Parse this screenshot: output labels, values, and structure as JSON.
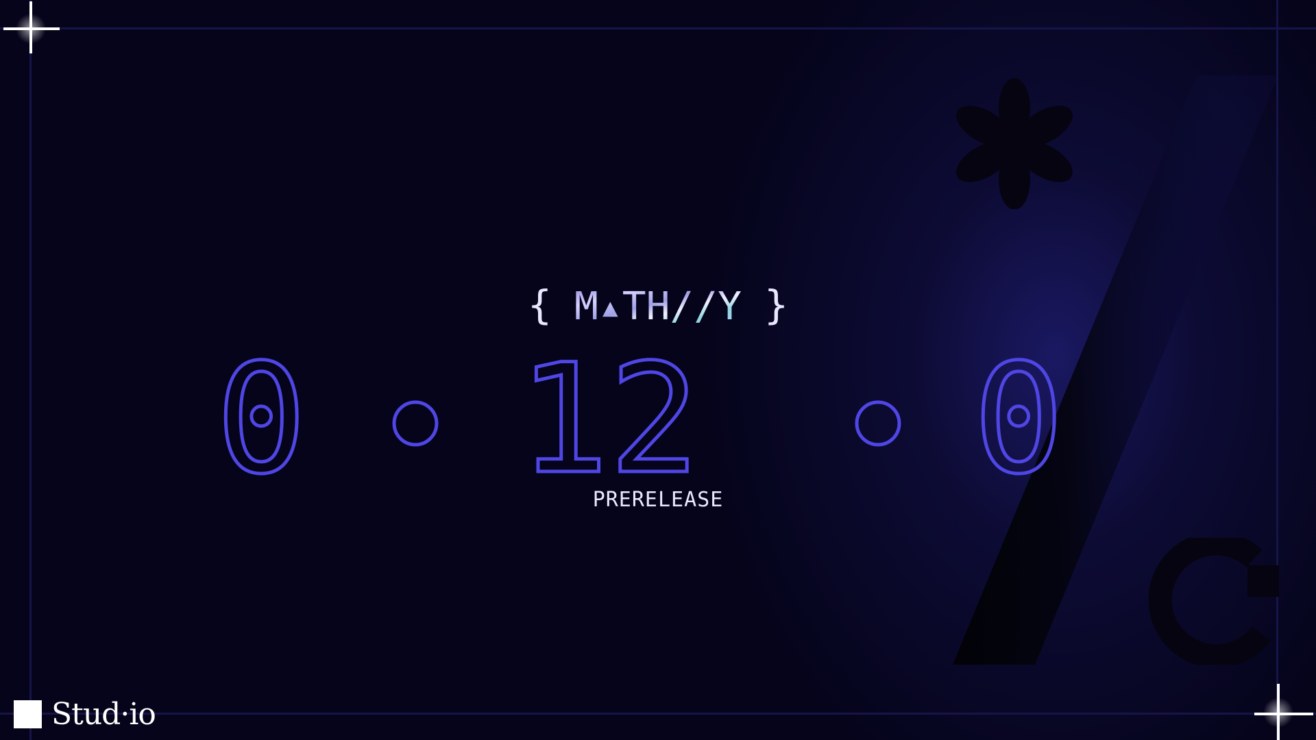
{
  "logo": {
    "brace_left": "{",
    "brace_right": "}",
    "wordmark": "M▴TH//Y"
  },
  "version": {
    "major": "0",
    "minor": "12",
    "patch": "0",
    "channel": "PRERELEASE"
  },
  "brand": {
    "name": "Stud·io"
  },
  "colors": {
    "background": "#05041a",
    "accent": "#4f46e5",
    "frame": "#16154a",
    "text": "#ece9ff"
  }
}
